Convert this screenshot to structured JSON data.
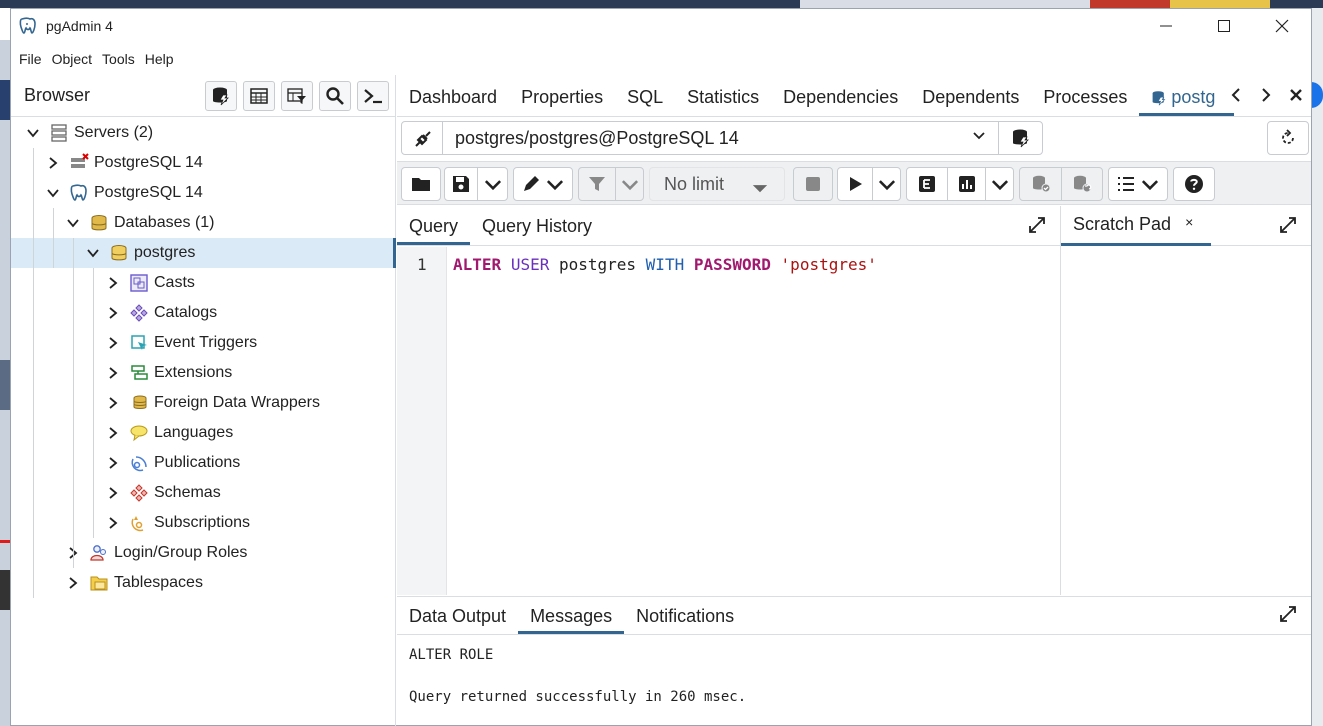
{
  "window": {
    "title": "pgAdmin 4"
  },
  "menu": [
    "File",
    "Object",
    "Tools",
    "Help"
  ],
  "browser": {
    "label": "Browser",
    "tree": [
      {
        "label": "Servers (2)",
        "icon": "servers-icon",
        "level": 0,
        "expanded": true
      },
      {
        "label": "PostgreSQL 14",
        "icon": "server-disconnected-icon",
        "level": 1,
        "expanded": false
      },
      {
        "label": "PostgreSQL 14",
        "icon": "elephant-icon",
        "level": 1,
        "expanded": true
      },
      {
        "label": "Databases (1)",
        "icon": "databases-icon",
        "level": 2,
        "expanded": true
      },
      {
        "label": "postgres",
        "icon": "database-icon",
        "level": 3,
        "expanded": true,
        "selected": true
      },
      {
        "label": "Casts",
        "icon": "casts-icon",
        "level": 4,
        "expanded": false
      },
      {
        "label": "Catalogs",
        "icon": "catalogs-icon",
        "level": 4,
        "expanded": false
      },
      {
        "label": "Event Triggers",
        "icon": "event-triggers-icon",
        "level": 4,
        "expanded": false
      },
      {
        "label": "Extensions",
        "icon": "extensions-icon",
        "level": 4,
        "expanded": false
      },
      {
        "label": "Foreign Data Wrappers",
        "icon": "fdw-icon",
        "level": 4,
        "expanded": false
      },
      {
        "label": "Languages",
        "icon": "languages-icon",
        "level": 4,
        "expanded": false
      },
      {
        "label": "Publications",
        "icon": "publications-icon",
        "level": 4,
        "expanded": false
      },
      {
        "label": "Schemas",
        "icon": "schemas-icon",
        "level": 4,
        "expanded": false
      },
      {
        "label": "Subscriptions",
        "icon": "subscriptions-icon",
        "level": 4,
        "expanded": false
      },
      {
        "label": "Login/Group Roles",
        "icon": "roles-icon",
        "level": 2,
        "expanded": false
      },
      {
        "label": "Tablespaces",
        "icon": "tablespaces-icon",
        "level": 2,
        "expanded": false
      }
    ]
  },
  "tabs": [
    "Dashboard",
    "Properties",
    "SQL",
    "Statistics",
    "Dependencies",
    "Dependents",
    "Processes"
  ],
  "active_tab": "postgres/postgres@PostgreSQL 14",
  "active_tab_visible": "postg",
  "connection": "postgres/postgres@PostgreSQL 14",
  "toolbar": {
    "limit": "No limit"
  },
  "editor": {
    "tabs": [
      "Query",
      "Query History"
    ],
    "line_number": "1",
    "tokens": [
      {
        "text": "ALTER",
        "cls": "kw1"
      },
      {
        "text": " ",
        "cls": "id"
      },
      {
        "text": "USER",
        "cls": "kw2"
      },
      {
        "text": " postgres ",
        "cls": "id"
      },
      {
        "text": "WITH",
        "cls": "kw3"
      },
      {
        "text": " ",
        "cls": "id"
      },
      {
        "text": "PASSWORD",
        "cls": "kw1"
      },
      {
        "text": " ",
        "cls": "id"
      },
      {
        "text": "'postgres'",
        "cls": "str"
      }
    ]
  },
  "scratch": {
    "label": "Scratch Pad",
    "close": "×"
  },
  "results": {
    "tabs": [
      "Data Output",
      "Messages",
      "Notifications"
    ],
    "active": "Messages",
    "lines": [
      "ALTER ROLE",
      "Query returned successfully in 260 msec."
    ]
  },
  "colors": {
    "accent": "#326690",
    "selected_bg": "#dbeaf7"
  }
}
